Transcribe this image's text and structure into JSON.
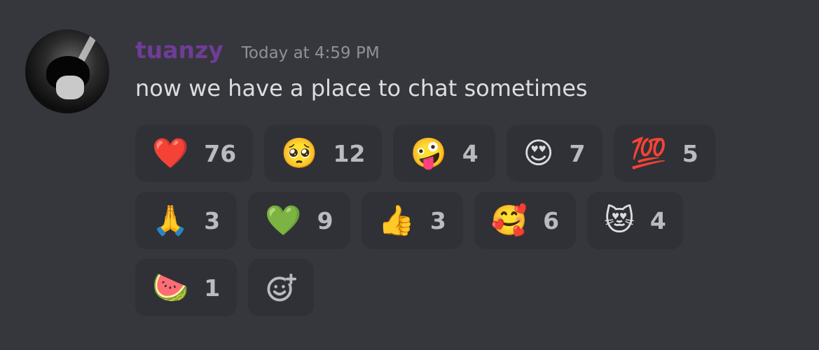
{
  "message": {
    "username": "tuanzy",
    "timestamp": "Today at 4:59 PM",
    "text": "now we have a place to chat sometimes"
  },
  "colors": {
    "background": "#36373d",
    "username": "#6f3c98",
    "reaction_bg": "#2f3136",
    "count_text": "#b9bbbe"
  },
  "reactions": [
    {
      "emoji": "❤️",
      "name": "heart",
      "count": "76"
    },
    {
      "emoji": "🥺",
      "name": "pleading-face",
      "count": "12"
    },
    {
      "emoji": "🤪",
      "name": "zany-face",
      "count": "4"
    },
    {
      "emoji": "😍",
      "name": "heart-eyes",
      "count": "7"
    },
    {
      "emoji": "💯",
      "name": "hundred-points",
      "count": "5"
    },
    {
      "emoji": "🙏",
      "name": "folded-hands",
      "count": "3"
    },
    {
      "emoji": "💚",
      "name": "green-heart",
      "count": "9"
    },
    {
      "emoji": "👍",
      "name": "thumbs-up",
      "count": "3"
    },
    {
      "emoji": "🥰",
      "name": "smiling-face-with-hearts",
      "count": "6"
    },
    {
      "emoji": "😻",
      "name": "heart-eyes-cat",
      "count": "4"
    },
    {
      "emoji": "🍉",
      "name": "watermelon",
      "count": "1"
    }
  ],
  "add_reaction_icon": "add-reaction-icon"
}
